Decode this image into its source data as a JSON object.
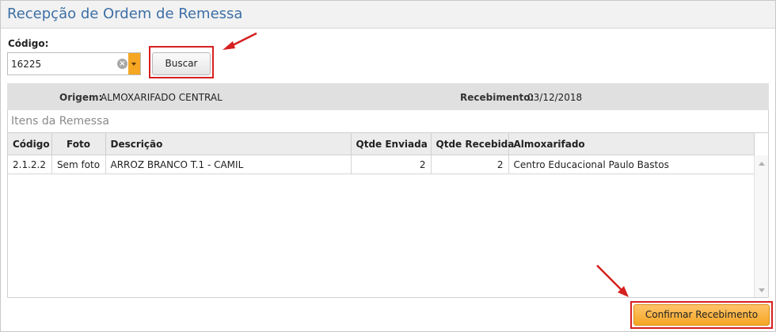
{
  "window": {
    "title": "Recepção de Ordem de Remessa"
  },
  "search": {
    "label": "Código:",
    "value": "16225",
    "clear_icon": "clear-icon",
    "dropdown_icon": "chevron-down-icon",
    "button_label": "Buscar"
  },
  "info": {
    "origem_label": "Origem:",
    "origem_value": "ALMOXARIFADO CENTRAL",
    "recebimento_label": "Recebimento:",
    "recebimento_value": "03/12/2018"
  },
  "items": {
    "title": "Itens da Remessa",
    "columns": [
      "Código",
      "Foto",
      "Descrição",
      "Qtde Enviada",
      "Qtde Recebida",
      "Almoxarifado"
    ],
    "rows": [
      {
        "codigo": "2.1.2.2",
        "foto": "Sem foto",
        "descricao": "ARROZ BRANCO T.1 - CAMIL",
        "qtde_enviada": "2",
        "qtde_recebida": "2",
        "almoxarifado": "Centro Educacional Paulo Bastos"
      }
    ]
  },
  "actions": {
    "confirm_label": "Confirmar Recebimento"
  },
  "colors": {
    "accent": "#f5a623",
    "title": "#3d6fa6",
    "highlight": "#d62020"
  }
}
